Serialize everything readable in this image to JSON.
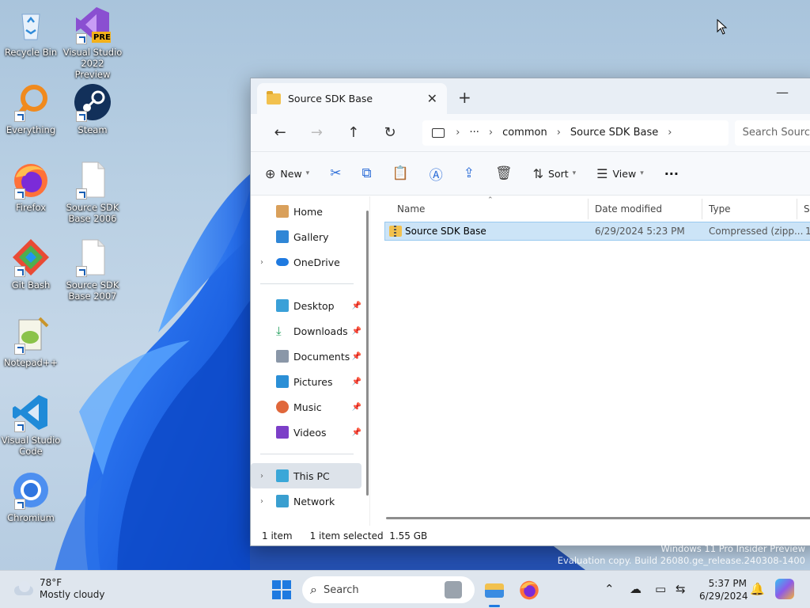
{
  "desktop": {
    "icons": [
      {
        "label": "Recycle Bin"
      },
      {
        "label": "Visual Studio 2022 Preview",
        "badge": "PRE"
      },
      {
        "label": "Everything"
      },
      {
        "label": "Steam"
      },
      {
        "label": "Firefox"
      },
      {
        "label": "Source SDK Base 2006"
      },
      {
        "label": "Git Bash"
      },
      {
        "label": "Source SDK Base 2007"
      },
      {
        "label": "Notepad++"
      },
      {
        "label": "Visual Studio Code"
      },
      {
        "label": "Chromium"
      }
    ],
    "watermark_line1": "Windows 11 Pro Insider Preview",
    "watermark_line2": "Evaluation copy. Build 26080.ge_release.240308-1400"
  },
  "explorer": {
    "tab_title": "Source SDK Base",
    "tab_close": "✕",
    "new_tab": "+",
    "minimize": "—",
    "nav": {
      "back": "←",
      "forward": "→",
      "up": "↑",
      "refresh": "↻"
    },
    "address": {
      "segments": [
        "common",
        "Source SDK Base"
      ],
      "ellipsis": "···"
    },
    "search_placeholder": "Search Source SDK Base",
    "toolbar": {
      "new_label": "New",
      "sort_label": "Sort",
      "view_label": "View",
      "more": "···"
    },
    "nav_pane": {
      "home": "Home",
      "gallery": "Gallery",
      "onedrive": "OneDrive",
      "desktop": "Desktop",
      "downloads": "Downloads",
      "documents": "Documents",
      "pictures": "Pictures",
      "music": "Music",
      "videos": "Videos",
      "this_pc": "This PC",
      "network": "Network"
    },
    "columns": {
      "name": "Name",
      "date": "Date modified",
      "type": "Type",
      "size": "S"
    },
    "files": [
      {
        "name": "Source SDK Base",
        "date": "6/29/2024 5:23 PM",
        "type": "Compressed (zipp...",
        "size": "1"
      }
    ],
    "status": {
      "count": "1 item",
      "selected": "1 item selected  1.55 GB"
    }
  },
  "taskbar": {
    "weather_temp": "78°F",
    "weather_desc": "Mostly cloudy",
    "search_label": "Search",
    "time": "5:37 PM",
    "date": "6/29/2024"
  }
}
